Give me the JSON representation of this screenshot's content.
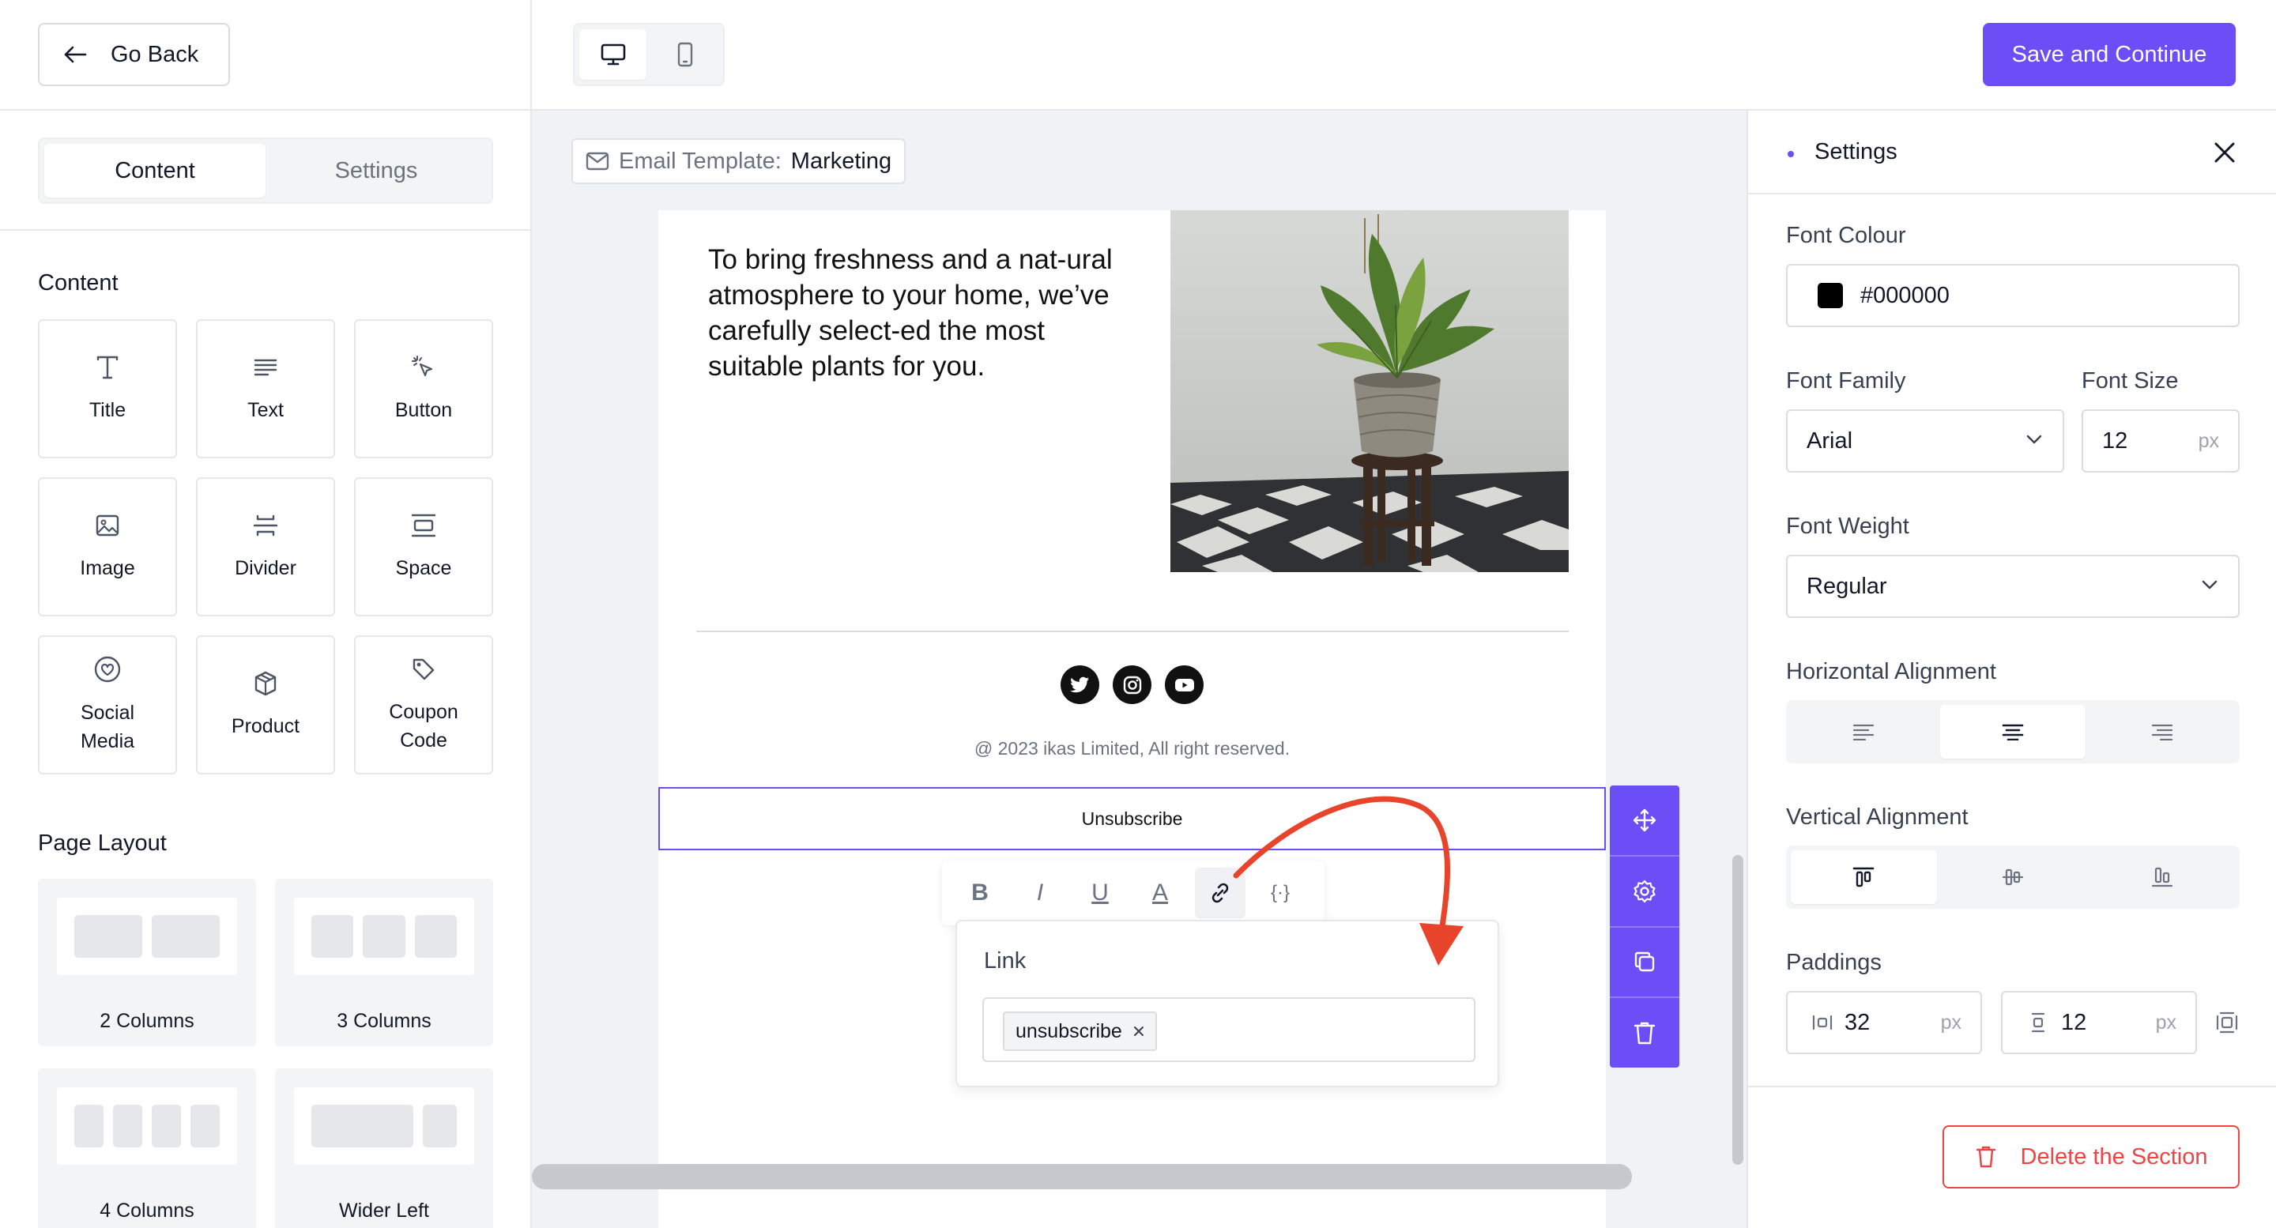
{
  "header": {
    "go_back": "Go Back",
    "save_continue": "Save and Continue"
  },
  "left_panel": {
    "tabs": [
      {
        "label": "Content",
        "active": true
      },
      {
        "label": "Settings",
        "active": false
      }
    ],
    "content_title": "Content",
    "content_items": [
      {
        "label": "Title",
        "icon": "title-icon"
      },
      {
        "label": "Text",
        "icon": "text-icon"
      },
      {
        "label": "Button",
        "icon": "button-pointer-icon"
      },
      {
        "label": "Image",
        "icon": "image-icon"
      },
      {
        "label": "Divider",
        "icon": "divider-icon"
      },
      {
        "label": "Space",
        "icon": "space-icon"
      },
      {
        "label": "Social Media",
        "icon": "social-heart-icon"
      },
      {
        "label": "Product",
        "icon": "product-box-icon"
      },
      {
        "label": "Coupon Code",
        "icon": "coupon-tag-icon"
      }
    ],
    "layout_title": "Page Layout",
    "layouts": [
      {
        "label": "2 Columns"
      },
      {
        "label": "3 Columns"
      },
      {
        "label": "4 Columns"
      },
      {
        "label": "Wider Left"
      }
    ]
  },
  "canvas": {
    "template_key": "Email Template:",
    "template_value": "Marketing",
    "body_text": "To bring freshness and a nat-ural atmosphere to your home, we’ve carefully select-ed the most suitable plants for you.",
    "copyright": "@ 2023 ikas Limited, All right reserved.",
    "unsubscribe": "Unsubscribe",
    "format_tools": [
      "B",
      "I",
      "U",
      "A"
    ],
    "variable_tool": "{·}",
    "link_popup": {
      "title": "Link",
      "chip": "unsubscribe"
    }
  },
  "settings_panel": {
    "title": "Settings",
    "font_colour_label": "Font Colour",
    "font_colour_value": "#000000",
    "font_family_label": "Font Family",
    "font_family_value": "Arial",
    "font_size_label": "Font Size",
    "font_size_value": "12",
    "font_size_unit": "px",
    "font_weight_label": "Font Weight",
    "font_weight_value": "Regular",
    "horizontal_alignment_label": "Horizontal Alignment",
    "horizontal_alignment_selected": "center",
    "vertical_alignment_label": "Vertical Alignment",
    "vertical_alignment_selected": "top",
    "paddings_label": "Paddings",
    "padding_horizontal": "32",
    "padding_vertical": "12",
    "padding_unit": "px",
    "delete_section": "Delete the Section"
  },
  "colors": {
    "accent": "#6B4EF6",
    "danger": "#EF4444",
    "annotation_arrow": "#E8432B"
  }
}
